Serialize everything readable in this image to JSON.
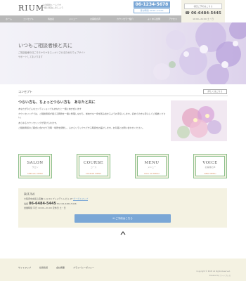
{
  "header": {
    "logo": "RIUM",
    "tagline_1": "心の相談ルームです",
    "tagline_2": "一緒に解決しましょう",
    "phone": "06-1234-5678",
    "phone_hours": "受付時間 10:00~21:00"
  },
  "right_column": {
    "first_visit": "初回ご予約はこちら",
    "phone": "☎ 06-6484-5445",
    "hours": "10:00~21:00 土・日",
    "reserve_button": "ご予約はこちら"
  },
  "nav": {
    "items": [
      "ホーム",
      "コンセプト",
      "料金表",
      "メニュー",
      "お客様の声",
      "カウンセラー紹介",
      "よくある質問",
      "アクセス"
    ]
  },
  "hero": {
    "title": "いつもご相談者様と共に",
    "subtitle_1": "ご相談者様の日ごろモヤモヤをスッキリさせるためのウェブサイト",
    "subtitle_2": "サポートしてまいります"
  },
  "concept": {
    "label": "コンセプト",
    "more": "詳しくはこちら",
    "heading": "つらい方も、ちょっとつらい方も　あなたと共に",
    "p1": "あなたが今どんなコンディションでもあなたと一緒に向き合います",
    "p2": "カウンセリングでは、ご相談者様が抱える問題を一緒に整理しながら、前向きな一歩を踏み出せるようお手伝いします。初めての方も安心してご相談ください。",
    "p3": "あらゆるカウンセリングが受けられます。",
    "p4": "ご相談者様のご都合に合わせて日時・場所を調整し、心からリラックスできる時間をお届けします。お気軽にお問い合わせください。"
  },
  "tiles": [
    {
      "en": "SALON",
      "jp": "サロン",
      "sub": "SPECIAL MENU"
    },
    {
      "en": "COURSE",
      "jp": "コース",
      "sub": "COURSE MENU"
    },
    {
      "en": "MENU",
      "jp": "メニュー",
      "sub": "PICK UP MENU"
    },
    {
      "en": "VOICE",
      "jp": "お客様の声",
      "sub": "NEW MENU"
    }
  ],
  "info": {
    "name": "RIUM",
    "address": "大阪府中央区心斎橋 1-12-16 プレジデントビル 2F",
    "map_link": "グーグルマップ",
    "tel_label": "電話",
    "tel": "06-6484-5445",
    "fax": "FAX 06-6484-5446",
    "hours_label": "営業時間",
    "hours": "平日 10:00~21:00",
    "closed": "定休日 土・日",
    "button": "ご予約はこちら"
  },
  "footer": {
    "links": [
      "サイトマップ",
      "採用情報",
      "会社概要",
      "プライバシーポリシー"
    ],
    "copyright": "Copyright © RIUM All Rights Reserved.",
    "powered": "Powered by ワードプレス"
  }
}
